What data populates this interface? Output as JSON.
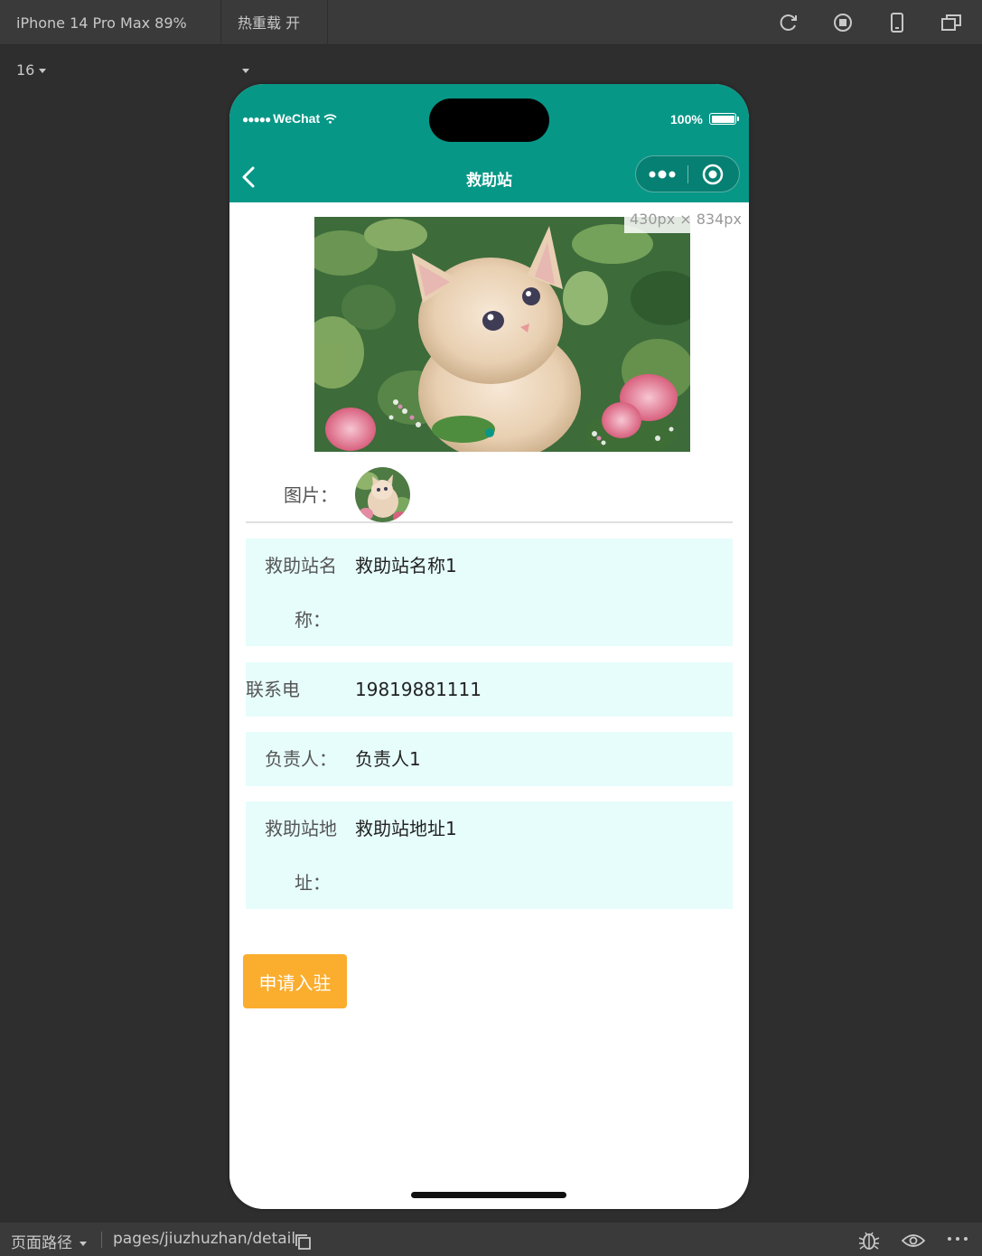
{
  "toolbar": {
    "device": "iPhone 14 Pro Max 89% 16",
    "hot_reload": "热重载 开",
    "icons": [
      "refresh-icon",
      "stop-icon",
      "phone-icon",
      "window-icon"
    ]
  },
  "status_bar": {
    "carrier": "WeChat",
    "battery": "100%"
  },
  "nav": {
    "title": "救助站"
  },
  "swiper": {
    "size_tip": "430px × 834px",
    "active_index": 0,
    "dots": 1
  },
  "fields": {
    "image_label": "图片：",
    "name": {
      "label_line1": "救助站名",
      "label_line2": "称：",
      "value": "救助站名称1"
    },
    "phone": {
      "label": "联系电话：",
      "value": "19819881111"
    },
    "owner": {
      "label": "负责人：",
      "value": "负责人1"
    },
    "address": {
      "label_line1": "救助站地",
      "label_line2": "址：",
      "value": "救助站地址1"
    }
  },
  "actions": {
    "apply": "申请入驻"
  },
  "bottom_bar": {
    "path_label": "页面路径",
    "path_value": "pages/jiuzhuzhan/detail"
  },
  "colors": {
    "theme": "#079787",
    "field_bg": "#e6fdfb",
    "apply_button": "#fbad2e"
  }
}
